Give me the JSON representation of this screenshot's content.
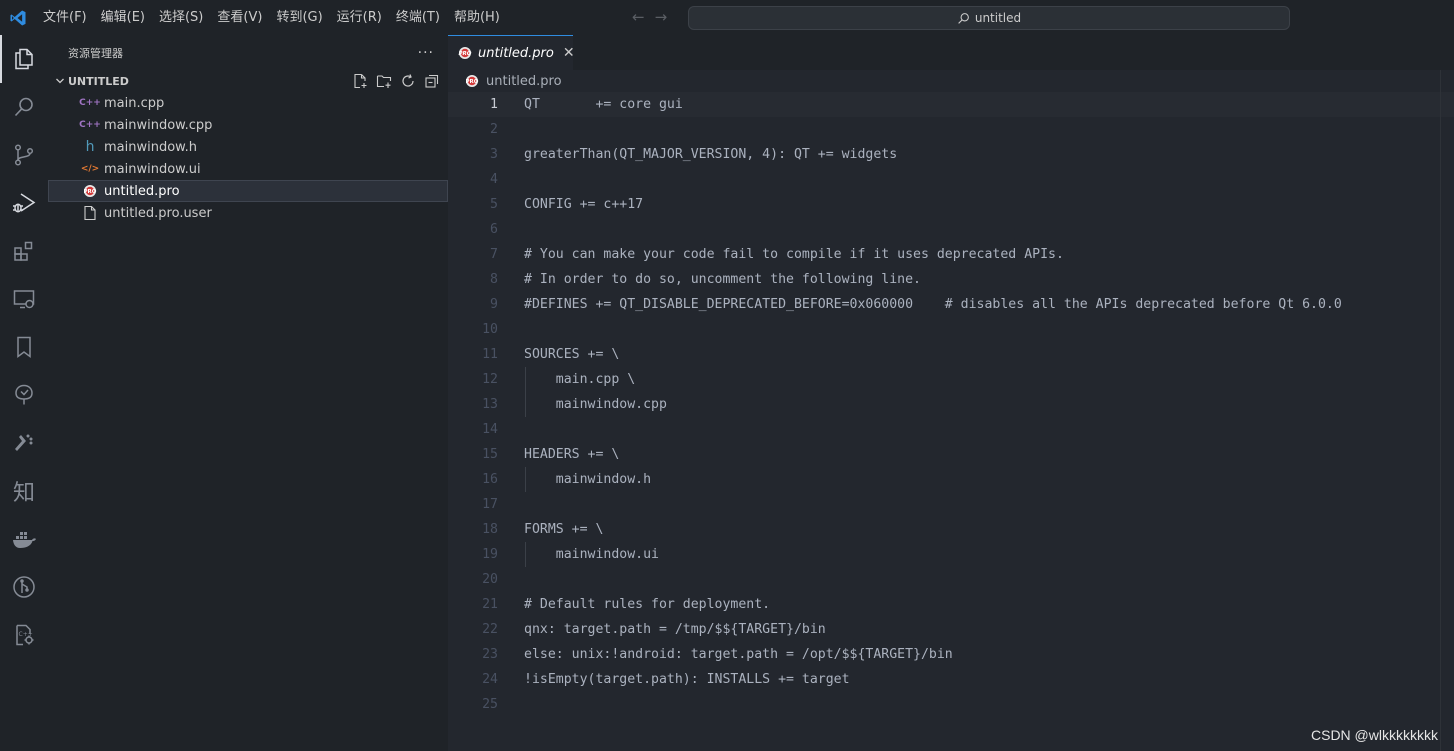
{
  "menu": [
    "文件(F)",
    "编辑(E)",
    "选择(S)",
    "查看(V)",
    "转到(G)",
    "运行(R)",
    "终端(T)",
    "帮助(H)"
  ],
  "command_center": {
    "text": "untitled",
    "icon": "search-icon"
  },
  "nav": {
    "back": "←",
    "forward": "→"
  },
  "activity_bar": [
    {
      "name": "explorer-icon",
      "active": true
    },
    {
      "name": "search-icon"
    },
    {
      "name": "source-control-icon"
    },
    {
      "name": "run-debug-icon"
    },
    {
      "name": "extensions-icon"
    },
    {
      "name": "remote-explorer-icon"
    },
    {
      "name": "bookmarks-icon"
    },
    {
      "name": "tree-view-icon"
    },
    {
      "name": "cmake-icon"
    },
    {
      "name": "zhihu-icon",
      "glyph": "知"
    },
    {
      "name": "docker-icon"
    },
    {
      "name": "git-graph-icon"
    },
    {
      "name": "cpp-settings-icon"
    }
  ],
  "sidebar": {
    "title": "资源管理器",
    "more": "···",
    "section": "UNTITLED",
    "files": [
      {
        "name": "main.cpp",
        "icon": "cpp-icon",
        "glyph": "C++",
        "color": "#a074c4"
      },
      {
        "name": "mainwindow.cpp",
        "icon": "cpp-icon",
        "glyph": "C++",
        "color": "#a074c4"
      },
      {
        "name": "mainwindow.h",
        "icon": "header-icon",
        "glyph": "h",
        "color": "#519aba"
      },
      {
        "name": "mainwindow.ui",
        "icon": "xml-icon",
        "glyph": "</>",
        "color": "#e37933"
      },
      {
        "name": "untitled.pro",
        "icon": "qt-pro-icon",
        "selected": true
      },
      {
        "name": "untitled.pro.user",
        "icon": "file-icon"
      }
    ]
  },
  "editor": {
    "tab": {
      "label": "untitled.pro",
      "close": "✕"
    },
    "breadcrumb": "untitled.pro",
    "current_line": 1,
    "lines": [
      "QT       += core gui",
      "",
      "greaterThan(QT_MAJOR_VERSION, 4): QT += widgets",
      "",
      "CONFIG += c++17",
      "",
      "# You can make your code fail to compile if it uses deprecated APIs.",
      "# In order to do so, uncomment the following line.",
      "#DEFINES += QT_DISABLE_DEPRECATED_BEFORE=0x060000    # disables all the APIs deprecated before Qt 6.0.0",
      "",
      "SOURCES += \\",
      "    main.cpp \\",
      "    mainwindow.cpp",
      "",
      "HEADERS += \\",
      "    mainwindow.h",
      "",
      "FORMS += \\",
      "    mainwindow.ui",
      "",
      "# Default rules for deployment.",
      "qnx: target.path = /tmp/$${TARGET}/bin",
      "else: unix:!android: target.path = /opt/$${TARGET}/bin",
      "!isEmpty(target.path): INSTALLS += target",
      ""
    ],
    "indented_lines": [
      12,
      13,
      16,
      19
    ]
  },
  "watermark": "CSDN @wlkkkkkkkk"
}
